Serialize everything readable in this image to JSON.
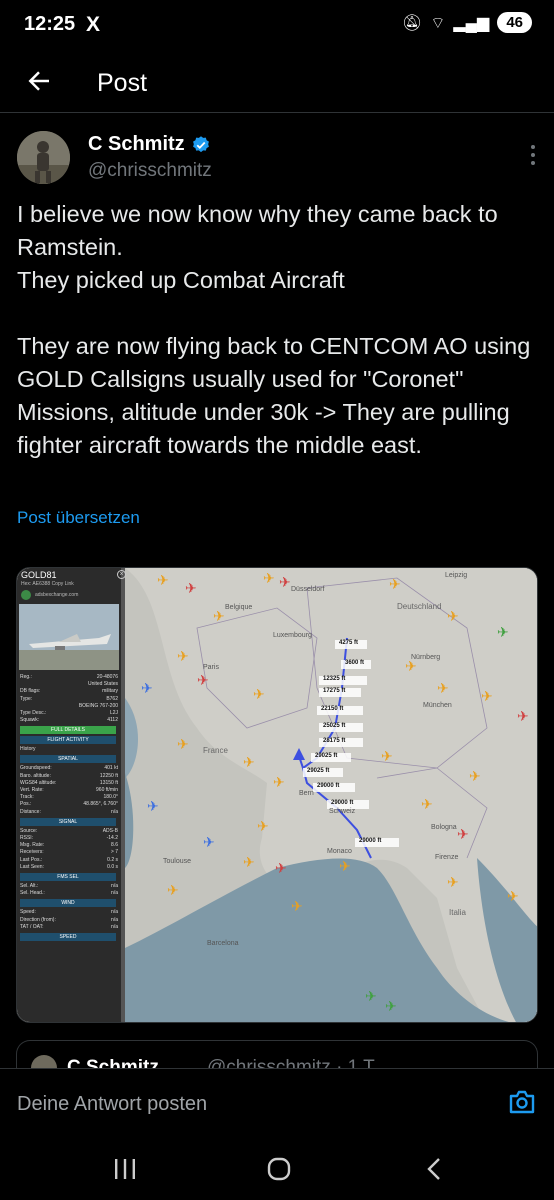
{
  "status": {
    "time": "12:25",
    "app_glyph": "X",
    "battery": "46"
  },
  "header": {
    "title": "Post"
  },
  "author": {
    "name": "C Schmitz",
    "handle": "@chrisschmitz"
  },
  "post": {
    "text": "I believe we now know why they came back to Ramstein.\nThey picked up Combat Aircraft\n\nThey are now flying back to CENTCOM AO using GOLD Callsigns usually used for \"Coronet\" Missions, altitude under 30k -> They are pulling fighter aircraft towards the middle east.",
    "translate_label": "Post übersetzen"
  },
  "media": {
    "panel": {
      "callsign": "GOLD81",
      "hex_line": "Hex: AE6388   Copy Link",
      "site": "adsbexchange.com",
      "rows": [
        [
          "Reg.:",
          "20-48076"
        ],
        [
          "",
          "United States"
        ],
        [
          "DB flags:",
          "military"
        ],
        [
          "Type:",
          "B762"
        ],
        [
          "",
          "BOEING 767-200"
        ],
        [
          "Type Desc.:",
          "L2J"
        ],
        [
          "Squawk:",
          "4112"
        ]
      ],
      "full_details": "FULL DETAILS",
      "flight_activity": "FLIGHT ACTIVITY",
      "history": "History",
      "spatial": "SPATIAL",
      "spatial_rows": [
        [
          "Groundspeed:",
          "401 kt"
        ],
        [
          "Baro. altitude:",
          "12250 ft"
        ],
        [
          "WGS84 altitude:",
          "13150 ft"
        ],
        [
          "Vert. Rate:",
          "960 ft/min"
        ],
        [
          "Track:",
          "180.0°"
        ],
        [
          "Pos.:",
          "48.865°, 6.760°"
        ],
        [
          "Distance:",
          "n/a"
        ]
      ],
      "signal": "SIGNAL",
      "signal_rows": [
        [
          "Source:",
          "ADS-B"
        ],
        [
          "RSSI:",
          "-14.2"
        ],
        [
          "Msg. Rate:",
          "8.6"
        ],
        [
          "Receivers:",
          "> 7"
        ],
        [
          "Last Pos.:",
          "0.2 s"
        ],
        [
          "Last Seen:",
          "0.0 s"
        ]
      ],
      "fms": "FMS SEL",
      "fms_rows": [
        [
          "Sel. Alt.:",
          "n/a"
        ],
        [
          "Sel. Head.:",
          "n/a"
        ]
      ],
      "wind": "WIND",
      "wind_rows": [
        [
          "Speed:",
          "n/a"
        ],
        [
          "Direction (from):",
          "n/a"
        ],
        [
          "TAT / OAT:",
          "n/a"
        ]
      ],
      "speed": "SPEED"
    },
    "map_labels": [
      "Leipzig",
      "Deutschland",
      "Düsseldorf",
      "Nürnberg",
      "München",
      "Paris",
      "France",
      "Belgique",
      "Luxembourg",
      "Bologna",
      "Firenze",
      "Toulouse",
      "Monaco",
      "Barcelona",
      "Italia",
      "Schweiz",
      "Bern"
    ],
    "track_labels": [
      "4275 ft",
      "3600 ft",
      "12325 ft",
      "17275 ft",
      "22150 ft",
      "25025 ft",
      "28175 ft",
      "29025 ft",
      "29025 ft",
      "29000 ft",
      "29000 ft",
      "29000 ft"
    ]
  },
  "reply": {
    "peek_name": "C Schmitz",
    "peek_handle": "@chrisschmitz · 1 T",
    "placeholder": "Deine Antwort posten"
  },
  "colors": {
    "accent": "#1d9bf0",
    "track": "#3d4fe0",
    "plane": "#e8a020"
  }
}
